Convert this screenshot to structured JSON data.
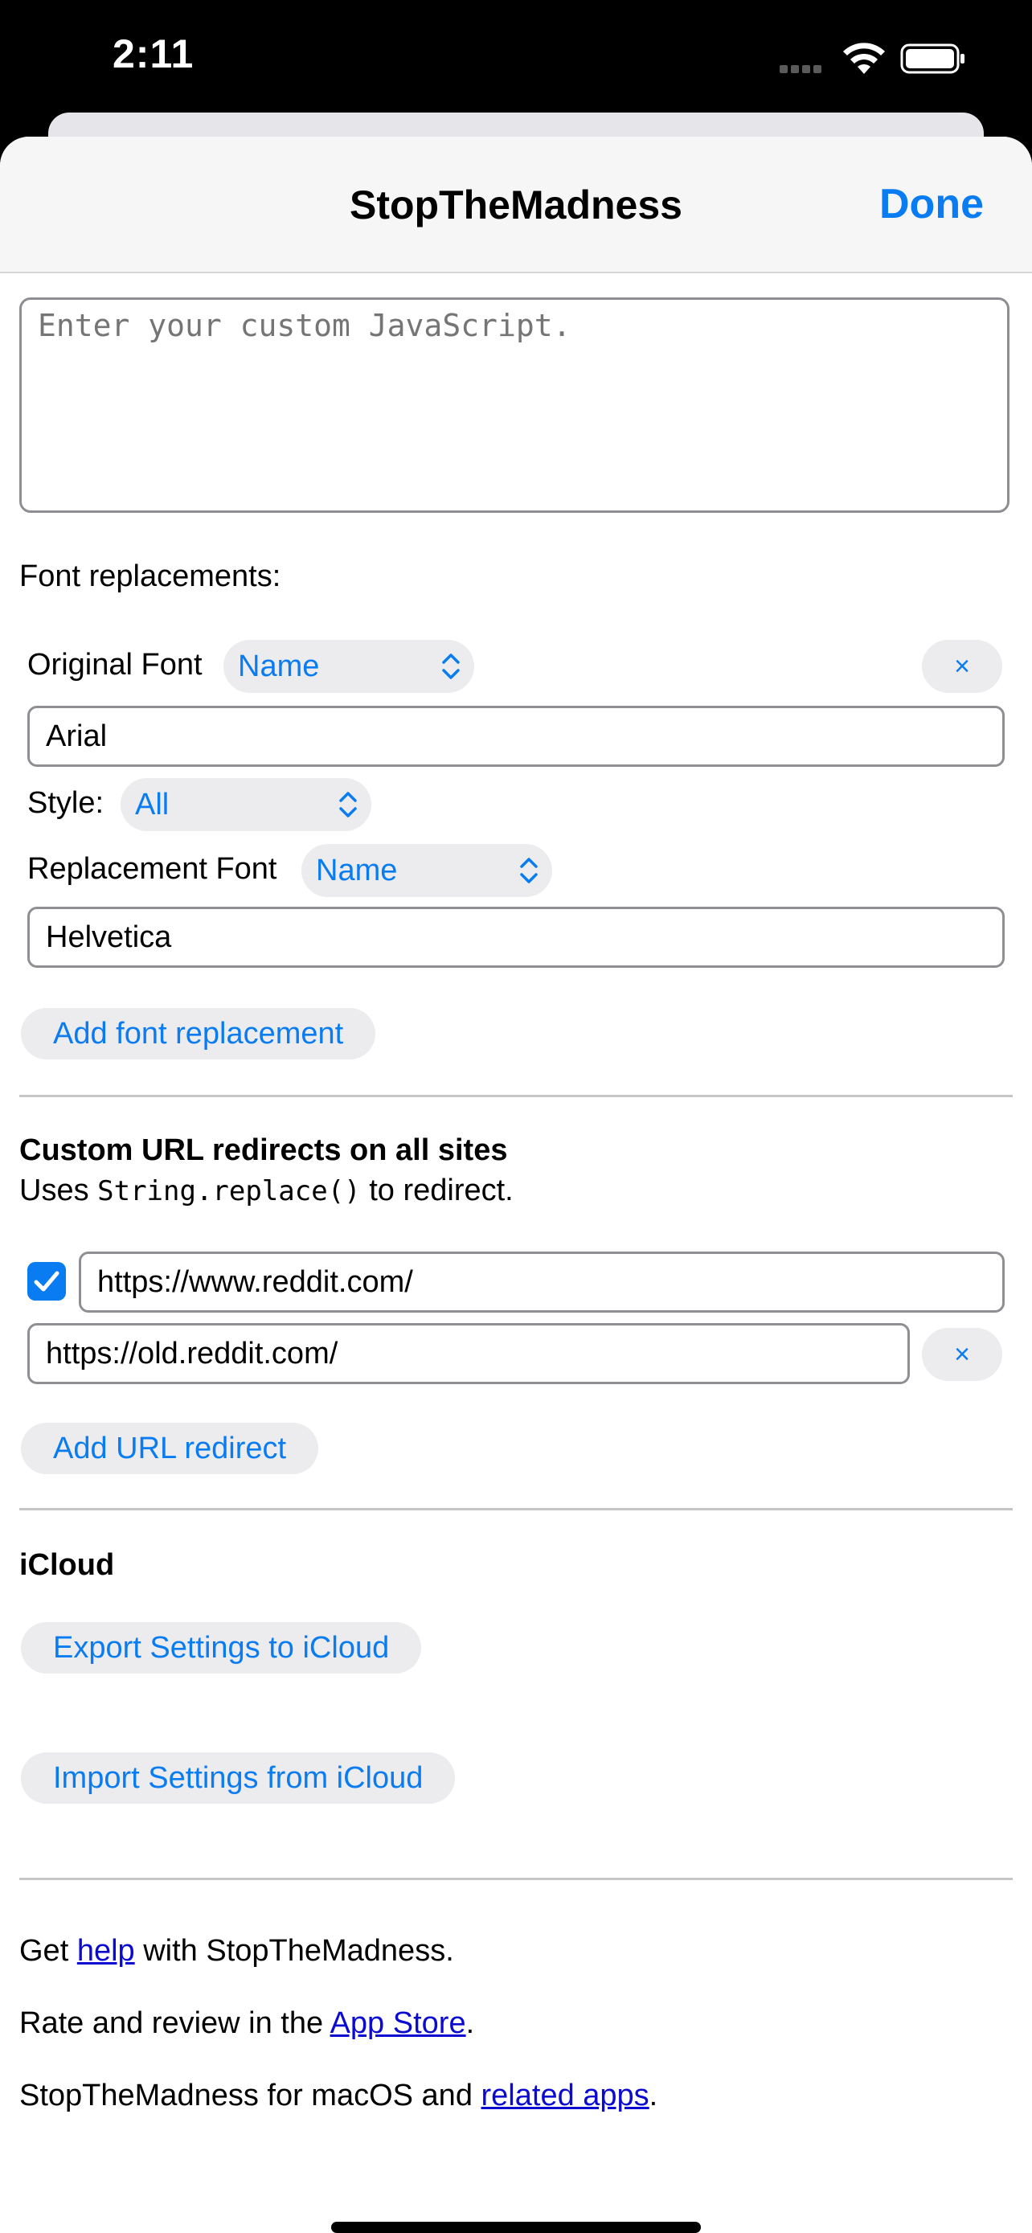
{
  "status": {
    "time": "2:11"
  },
  "nav": {
    "title": "StopTheMadness",
    "done_label": "Done"
  },
  "custom_js": {
    "placeholder": "Enter your custom JavaScript."
  },
  "fonts": {
    "heading": "Font replacements:",
    "original_label": "Original Font",
    "original_type": "Name",
    "original_value": "Arial",
    "style_label": "Style:",
    "style_value": "All",
    "replacement_label": "Replacement Font",
    "replacement_type": "Name",
    "replacement_value": "Helvetica",
    "remove_label": "×",
    "add_label": "Add font replacement"
  },
  "redirects": {
    "heading": "Custom URL redirects on all sites",
    "desc_prefix": "Uses ",
    "desc_code": "String.replace()",
    "desc_suffix": " to redirect.",
    "enabled": true,
    "from_value": "https://www.reddit.com/",
    "to_value": "https://old.reddit.com/",
    "remove_label": "×",
    "add_label": "Add URL redirect"
  },
  "icloud": {
    "heading": "iCloud",
    "export_label": "Export Settings to iCloud",
    "import_label": "Import Settings from iCloud"
  },
  "footer": {
    "help_prefix": "Get ",
    "help_link": "help",
    "help_suffix": " with StopTheMadness.",
    "rate_prefix": "Rate and review in the ",
    "rate_link": "App Store",
    "rate_suffix": ".",
    "mac_prefix": "StopTheMadness for macOS and ",
    "mac_link": "related apps",
    "mac_suffix": "."
  },
  "colors": {
    "accent": "#0a7cf2",
    "link": "#0a0ad0"
  }
}
